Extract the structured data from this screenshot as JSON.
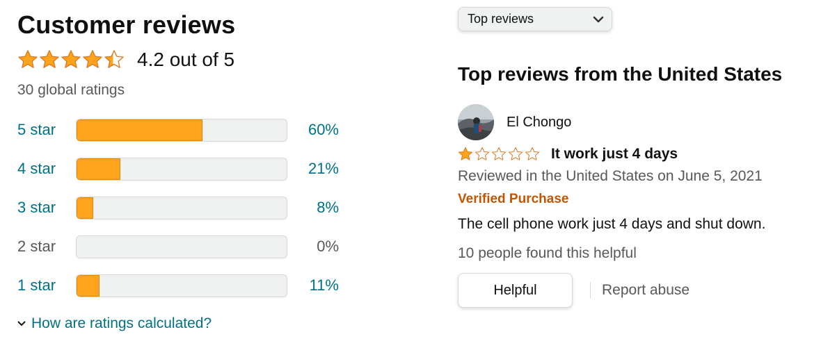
{
  "summary": {
    "title": "Customer reviews",
    "rating_value": 4.2,
    "rating_text": "4.2 out of 5",
    "global_ratings": "30 global ratings",
    "star_color": "#ffa41c",
    "histogram": [
      {
        "label": "5 star",
        "percent": 60,
        "percent_text": "60%"
      },
      {
        "label": "4 star",
        "percent": 21,
        "percent_text": "21%"
      },
      {
        "label": "3 star",
        "percent": 8,
        "percent_text": "8%"
      },
      {
        "label": "2 star",
        "percent": 0,
        "percent_text": "0%"
      },
      {
        "label": "1 star",
        "percent": 11,
        "percent_text": "11%"
      }
    ],
    "how_link": "How are ratings calculated?"
  },
  "sort": {
    "selected": "Top reviews",
    "icon": "chevron-down-icon"
  },
  "reviews_section": {
    "title": "Top reviews from the United States",
    "reviews": [
      {
        "reviewer": "El Chongo",
        "rating": 1,
        "title": "It work just 4 days",
        "date_text": "Reviewed in the United States on June 5, 2021",
        "badge": "Verified Purchase",
        "body": "The cell phone work just 4 days and shut down.",
        "helpful_count_text": "10 people found this helpful",
        "helpful_button": "Helpful",
        "report_link": "Report abuse"
      }
    ]
  }
}
